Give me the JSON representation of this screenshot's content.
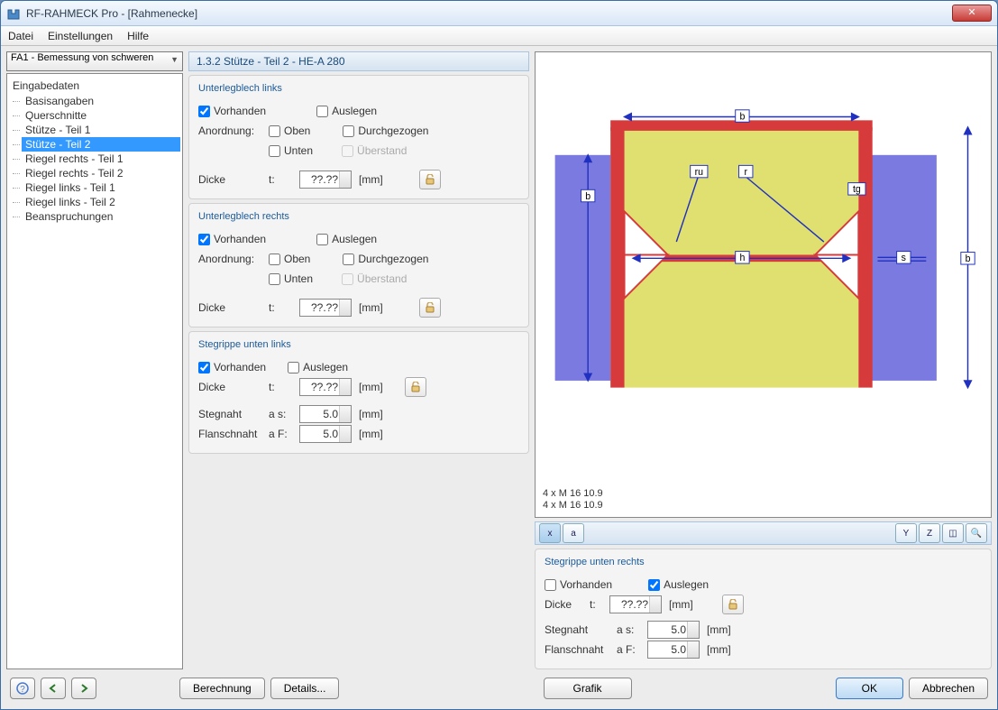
{
  "window": {
    "title": "RF-RAHMECK Pro - [Rahmenecke]"
  },
  "menus": {
    "file": "Datei",
    "settings": "Einstellungen",
    "help": "Hilfe"
  },
  "combo": {
    "label": "FA1 - Bemessung von schweren"
  },
  "tree": {
    "root": "Eingabedaten",
    "items": [
      "Basisangaben",
      "Querschnitte",
      "Stütze - Teil 1",
      "Stütze - Teil 2",
      "Riegel rechts - Teil 1",
      "Riegel rechts - Teil 2",
      "Riegel links - Teil 1",
      "Riegel links - Teil 2",
      "Beanspruchungen"
    ],
    "selected": 3
  },
  "page": {
    "title": "1.3.2 Stütze - Teil 2 - HE-A 280"
  },
  "labels": {
    "vorhanden": "Vorhanden",
    "auslegen": "Auslegen",
    "anordnung": "Anordnung:",
    "oben": "Oben",
    "unten": "Unten",
    "durchgezogen": "Durchgezogen",
    "ueberstand": "Überstand",
    "dicke": "Dicke",
    "t": "t:",
    "mm": "[mm]",
    "stegnaht": "Stegnaht",
    "flanschnaht": "Flanschnaht",
    "as": "a s:",
    "af": "a F:"
  },
  "groups": {
    "u_links": {
      "title": "Unterlegblech links",
      "vorhanden": true,
      "auslegen": false,
      "oben": false,
      "unten": false,
      "durchgezogen": false,
      "ueberstand": false,
      "dicke": "??.??"
    },
    "u_rechts": {
      "title": "Unterlegblech rechts",
      "vorhanden": true,
      "auslegen": false,
      "oben": false,
      "unten": false,
      "durchgezogen": false,
      "ueberstand": false,
      "dicke": "??.??"
    },
    "s_links": {
      "title": "Stegrippe unten links",
      "vorhanden": true,
      "auslegen": false,
      "dicke": "??.??",
      "as": "5.0",
      "af": "5.0"
    },
    "s_rechts": {
      "title": "Stegrippe unten rechts",
      "vorhanden": false,
      "auslegen": true,
      "dicke": "??.??",
      "as": "5.0",
      "af": "5.0"
    }
  },
  "graphic": {
    "line1": "4 x M 16 10.9",
    "line2": "4 x M 16 10.9"
  },
  "buttons": {
    "berechnung": "Berechnung",
    "details": "Details...",
    "grafik": "Grafik",
    "ok": "OK",
    "abbrechen": "Abbrechen"
  },
  "diagram": {
    "labels": {
      "b": "b",
      "ru": "ru",
      "r": "r",
      "tg": "tg",
      "h": "h",
      "s": "s"
    }
  }
}
